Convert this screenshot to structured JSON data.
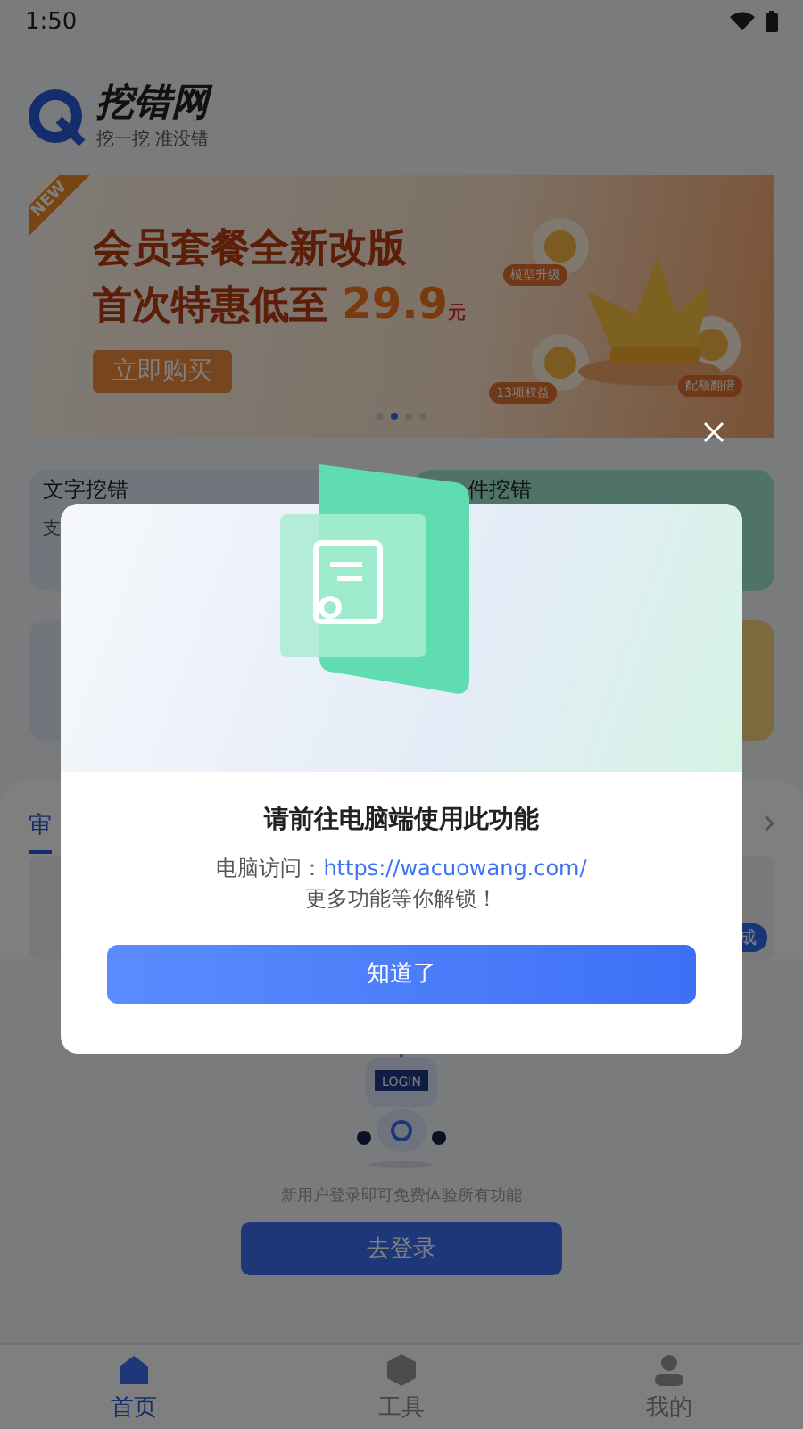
{
  "status_bar": {
    "time": "1:50"
  },
  "header": {
    "brand": "挖错网",
    "slogan": "挖一挖 准没错"
  },
  "banner": {
    "ribbon": "NEW",
    "headline": "会员套餐全新改版",
    "offer": "首次特惠低至",
    "price": "29.9",
    "unit": "元",
    "button": "立即购买",
    "perks": [
      "模型升级",
      "13项权益",
      "配额翻倍"
    ],
    "dots": [
      {
        "selected": false
      },
      {
        "selected": true
      },
      {
        "selected": false
      },
      {
        "selected": false
      }
    ]
  },
  "cards": [
    {
      "kind": "standard",
      "title": "文字挖错",
      "subtitle": "支"
    },
    {
      "kind": "featured",
      "title": "件挖错"
    },
    {
      "kind": "standard"
    },
    {
      "kind": "premium"
    }
  ],
  "section": {
    "tabs": [
      {
        "label": "审",
        "selected": true
      }
    ],
    "badge": "成"
  },
  "login": {
    "robot_screen": "LOGIN",
    "prompt": "新用户登录即可免费体验所有功能",
    "button": "去登录"
  },
  "tab_bar": [
    {
      "label": "首页",
      "selected": true
    },
    {
      "label": "工具",
      "selected": false
    },
    {
      "label": "我的",
      "selected": false
    }
  ],
  "dialog": {
    "title": "请前往电脑端使用此功能",
    "line_label": "电脑访问：",
    "link": "https://wacuowang.com/",
    "line2": "更多功能等你解锁！",
    "button": "知道了"
  }
}
